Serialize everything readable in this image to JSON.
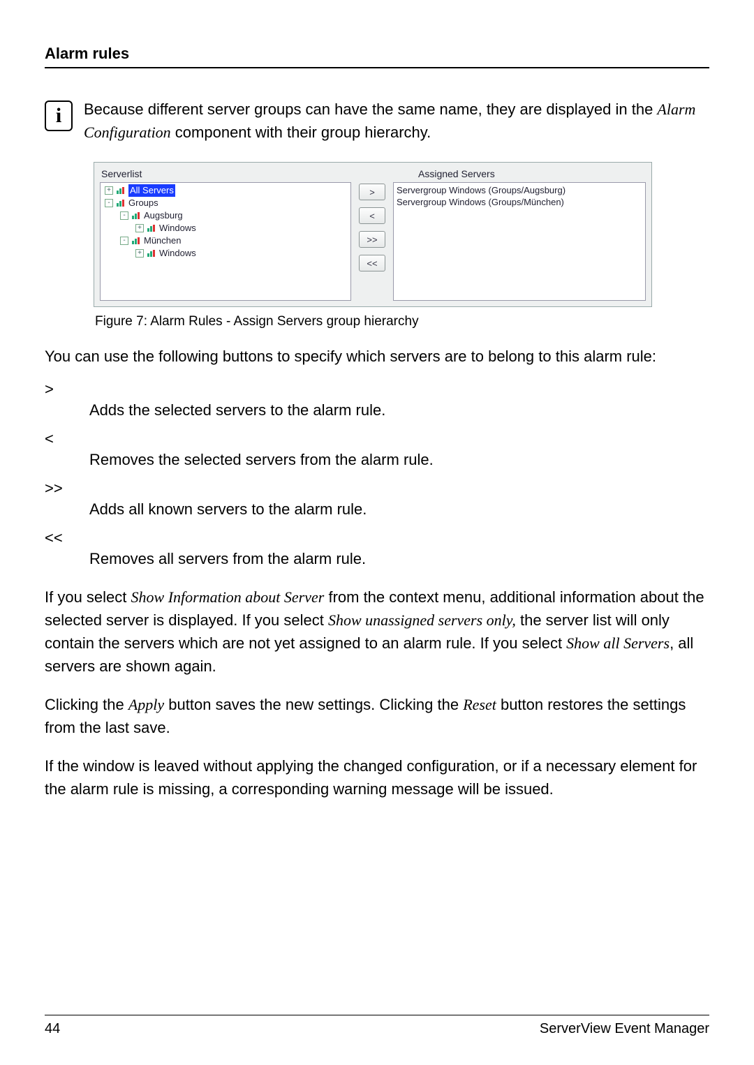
{
  "header": {
    "title": "Alarm rules"
  },
  "info": {
    "icon_glyph": "i",
    "text_pre": "Because different server groups can have the same name, they are displayed in the ",
    "component_name": "Alarm Configuration",
    "text_post": " component with their group hierarchy."
  },
  "panel": {
    "serverlist_label": "Serverlist",
    "assigned_label": "Assigned Servers",
    "buttons": {
      "add": ">",
      "remove": "<",
      "add_all": ">>",
      "remove_all": "<<"
    },
    "tree": [
      {
        "indent": 0,
        "pm": "+",
        "label": "All Servers",
        "selected": true
      },
      {
        "indent": 0,
        "pm": "-",
        "label": "Groups"
      },
      {
        "indent": 1,
        "pm": "-",
        "label": "Augsburg"
      },
      {
        "indent": 2,
        "pm": "+",
        "label": "Windows"
      },
      {
        "indent": 1,
        "pm": "-",
        "label": "München"
      },
      {
        "indent": 2,
        "pm": "+",
        "label": "Windows"
      }
    ],
    "assigned": [
      "Servergroup Windows (Groups/Augsburg)",
      "Servergroup Windows (Groups/München)"
    ]
  },
  "figure_caption": "Figure 7: Alarm Rules - Assign Servers group hierarchy",
  "para1": "You can use the following buttons to specify which servers are to belong to this alarm rule:",
  "defs": [
    {
      "term": ">",
      "desc": "Adds the selected servers to the alarm rule."
    },
    {
      "term": "<",
      "desc": "Removes the selected servers from the alarm rule."
    },
    {
      "term": ">>",
      "desc": "Adds all known servers to the alarm rule."
    },
    {
      "term": "<<",
      "desc": "Removes all servers from the alarm rule."
    }
  ],
  "para2": {
    "p1": "If you select ",
    "it1": "Show Information about Server",
    "p2": " from the context menu, additional information about the selected server is displayed. If you select ",
    "it2": "Show unassigned servers only,",
    "p3": " the server list will only contain the servers which are not yet assigned to an alarm rule. If you select ",
    "it3": "Show all Servers",
    "p4": ", all servers are shown again."
  },
  "para3": {
    "p1": "Clicking the ",
    "it1": "Apply",
    "p2": " button saves the new settings. Clicking the ",
    "it2": "Reset",
    "p3": " button restores the settings from the last save."
  },
  "para4": "If the window is leaved without applying the changed configuration, or if a necessary element for the alarm rule is missing, a corresponding warning message will be issued.",
  "footer": {
    "page": "44",
    "product": "ServerView Event Manager"
  }
}
